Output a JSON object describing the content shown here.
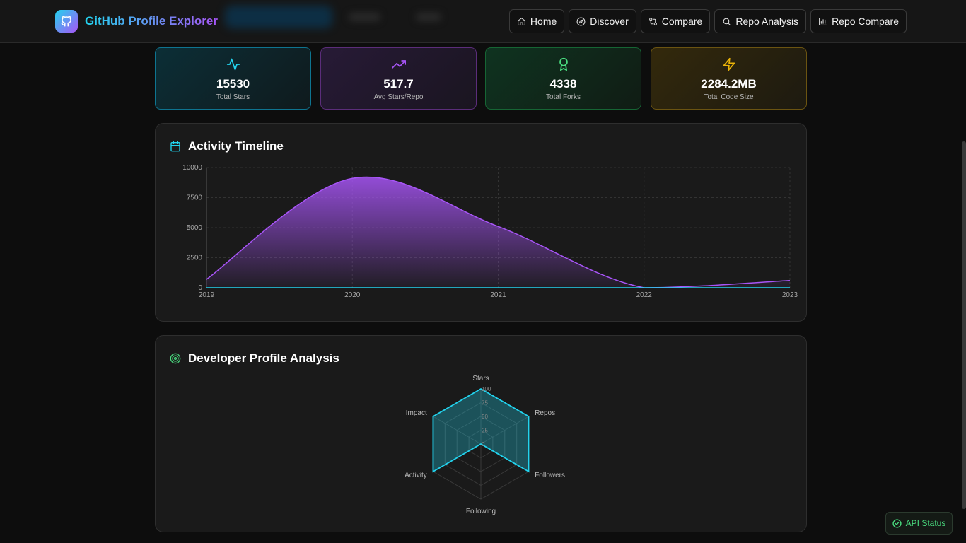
{
  "brand": {
    "title": "GitHub Profile Explorer"
  },
  "nav": [
    {
      "label": "Home",
      "icon": "home-icon"
    },
    {
      "label": "Discover",
      "icon": "compass-icon"
    },
    {
      "label": "Compare",
      "icon": "compare-icon"
    },
    {
      "label": "Repo Analysis",
      "icon": "search-icon"
    },
    {
      "label": "Repo Compare",
      "icon": "bar-chart-icon"
    }
  ],
  "stats": [
    {
      "value": "15530",
      "label": "Total Stars",
      "icon": "activity-icon",
      "color": "#22d3ee"
    },
    {
      "value": "517.7",
      "label": "Avg Stars/Repo",
      "icon": "trending-up-icon",
      "color": "#a855f7"
    },
    {
      "value": "4338",
      "label": "Total Forks",
      "icon": "award-icon",
      "color": "#4ade80"
    },
    {
      "value": "2284.2MB",
      "label": "Total Code Size",
      "icon": "zap-icon",
      "color": "#eab308"
    }
  ],
  "timeline": {
    "title": "Activity Timeline",
    "icon": "calendar-icon"
  },
  "profile": {
    "title": "Developer Profile Analysis",
    "icon": "target-icon"
  },
  "api_status": {
    "label": "API Status",
    "icon": "check-circle-icon"
  },
  "chart_data": [
    {
      "type": "area",
      "title": "Activity Timeline",
      "x": [
        "2019",
        "2020",
        "2021",
        "2022",
        "2023"
      ],
      "values": [
        700,
        9100,
        5100,
        0,
        600
      ],
      "ylim": [
        0,
        10000
      ],
      "yticks": [
        0,
        2500,
        5000,
        7500,
        10000
      ],
      "grid": true,
      "color": "#a855f7"
    },
    {
      "type": "radar",
      "title": "Developer Profile Analysis",
      "axes": [
        "Stars",
        "Repos",
        "Followers",
        "Following",
        "Activity",
        "Impact"
      ],
      "values": [
        100,
        100,
        100,
        0,
        100,
        100
      ],
      "range": [
        0,
        100
      ],
      "ticks": [
        0,
        25,
        50,
        75,
        100
      ],
      "color": "#22d3ee"
    }
  ]
}
